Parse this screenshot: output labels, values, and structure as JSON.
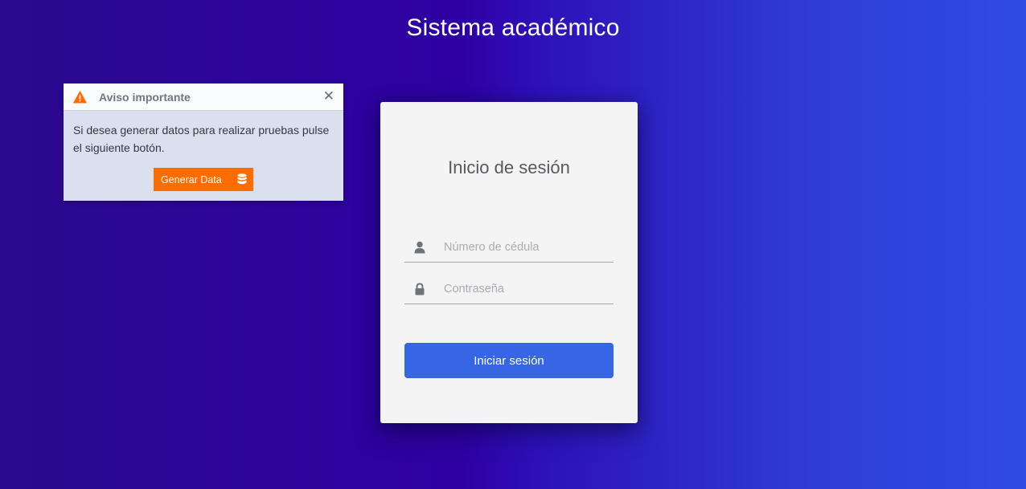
{
  "app_title": "Sistema académico",
  "notice": {
    "title": "Aviso importante",
    "message": "Si desea generar datos para realizar pruebas pulse el siguiente botón.",
    "close_glyph": "✕",
    "button_label": "Generar Data",
    "icons": {
      "title": "warning-icon",
      "button": "database-icon"
    }
  },
  "login": {
    "title": "Inicio de sesión",
    "id_field": {
      "placeholder": "Número de cédula",
      "value": "",
      "icon": "user-icon"
    },
    "password_field": {
      "placeholder": "Contraseña",
      "value": "",
      "icon": "lock-icon"
    },
    "submit_label": "Iniciar sesión"
  },
  "colors": {
    "accent_orange": "#ff6d00",
    "primary_blue": "#3666e4",
    "background_left": "#2a0a8e",
    "background_right": "#2f4be4"
  }
}
